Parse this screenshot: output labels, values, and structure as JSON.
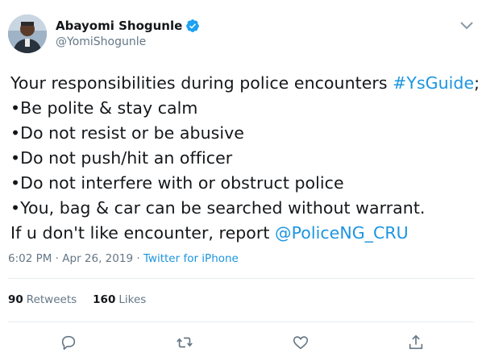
{
  "author": {
    "display_name": "Abayomi Shogunle",
    "handle": "@YomiShogunle",
    "verified": true,
    "avatar_icon": "profile-photo-uniformed-officer"
  },
  "tweet": {
    "line1_text": "Your responsibilities during police encounters ",
    "line1_hashtag": "#YsGuide",
    "line1_suffix": ";",
    "bullets": [
      "•Be polite & stay calm",
      "•Do not resist or be abusive",
      "•Do not push/hit an officer",
      "•Do not interfere with or obstruct police",
      "•You, bag & car can be searched without warrant."
    ],
    "last_line_text": "If u don't like encounter, report ",
    "last_line_mention": "@PoliceNG_CRU"
  },
  "meta": {
    "timestamp": "6:02 PM · Apr 26, 2019 · ",
    "source": "Twitter for iPhone"
  },
  "stats": {
    "retweets_count": "90",
    "retweets_label": "Retweets",
    "likes_count": "160",
    "likes_label": "Likes"
  },
  "actions": [
    "reply-icon",
    "retweet-icon",
    "like-icon",
    "share-icon"
  ],
  "colors": {
    "link": "#1b95e0",
    "secondary_text": "#657786",
    "primary_text": "#14171a",
    "divider": "#e6ecf0"
  }
}
